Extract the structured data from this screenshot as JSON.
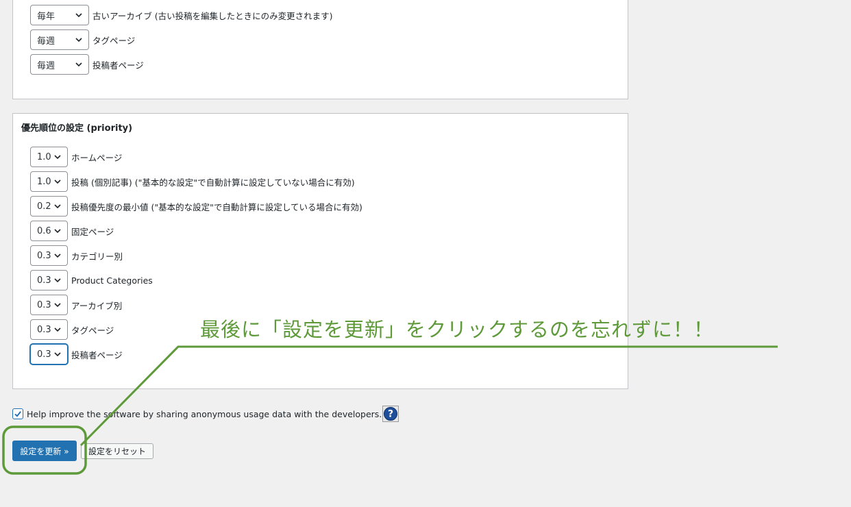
{
  "frequency": {
    "rows": [
      {
        "value": "毎年",
        "label": "古いアーカイブ (古い投稿を編集したときにのみ変更されます)"
      },
      {
        "value": "毎週",
        "label": "タグページ"
      },
      {
        "value": "毎週",
        "label": "投稿者ページ"
      }
    ]
  },
  "priority": {
    "title": "優先順位の設定 (priority)",
    "rows": [
      {
        "value": "1.0",
        "label": "ホームページ"
      },
      {
        "value": "1.0",
        "label": "投稿 (個別記事) (\"基本的な設定\"で自動計算に設定していない場合に有効)"
      },
      {
        "value": "0.2",
        "label": "投稿優先度の最小値 (\"基本的な設定\"で自動計算に設定している場合に有効)"
      },
      {
        "value": "0.6",
        "label": "固定ページ"
      },
      {
        "value": "0.3",
        "label": "カテゴリー別"
      },
      {
        "value": "0.3",
        "label": "Product Categories"
      },
      {
        "value": "0.3",
        "label": "アーカイブ別"
      },
      {
        "value": "0.3",
        "label": "タグページ"
      },
      {
        "value": "0.3",
        "label": "投稿者ページ"
      }
    ]
  },
  "usage": {
    "checked": true,
    "label": "Help improve the software by sharing anonymous usage data with the developers."
  },
  "buttons": {
    "save": "設定を更新 »",
    "reset": "設定をリセット"
  },
  "annotation": {
    "text": "最後に「設定を更新」をクリックするのを忘れずに！！",
    "color": "#5e9a3a"
  },
  "colors": {
    "primary": "#2271b1",
    "background": "#f0f0f1",
    "panel_border": "#c3c4c7"
  }
}
